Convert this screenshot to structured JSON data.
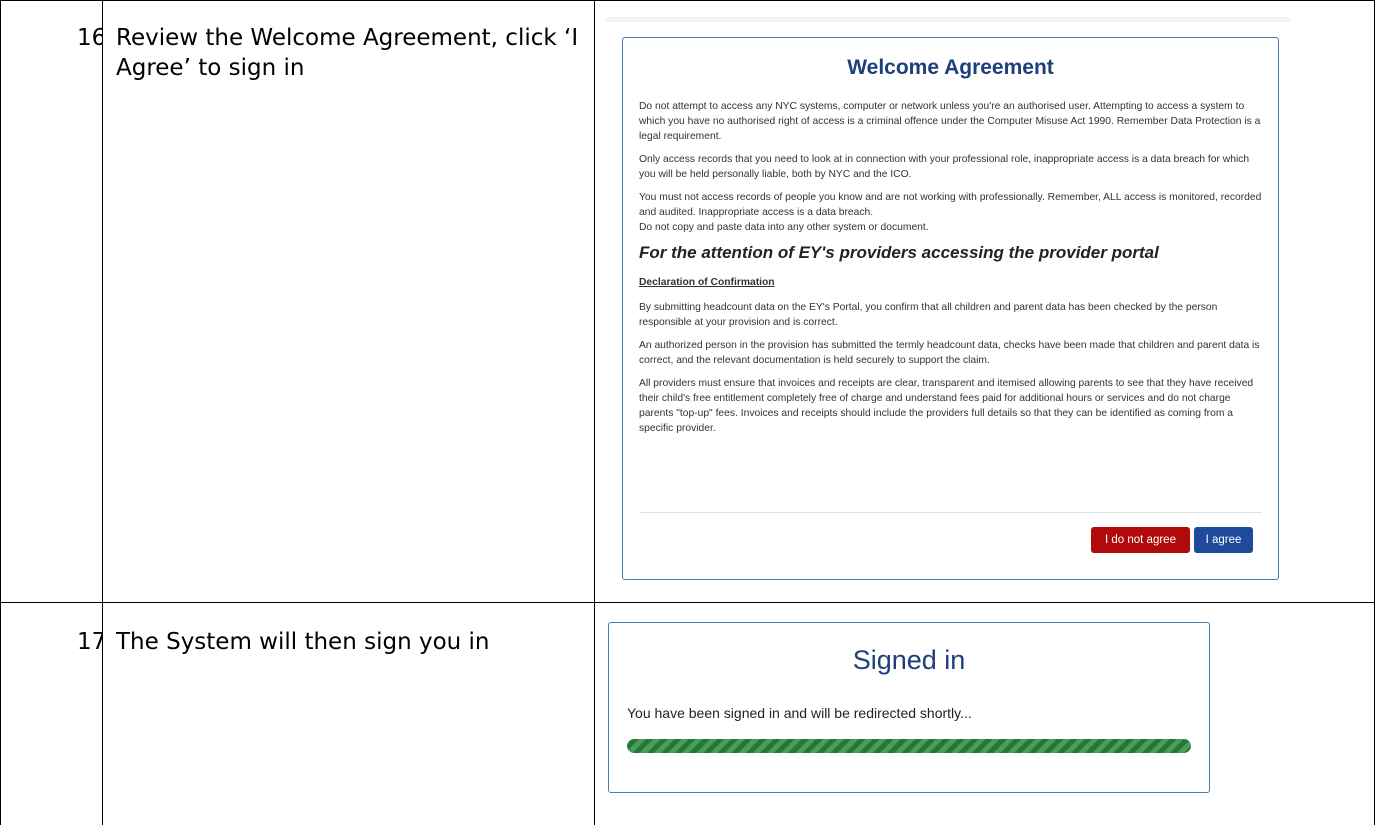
{
  "rows": [
    {
      "number": "16",
      "instruction": "Review the Welcome Agreement, click ‘I Agree’ to sign in"
    },
    {
      "number": "17",
      "instruction": "The System will then sign you in"
    }
  ],
  "welcome_agreement": {
    "title": "Welcome Agreement",
    "paragraphs": [
      "Do not attempt to access any NYC systems, computer or network unless you're an authorised user. Attempting to access a system to which you have no authorised right of access is a criminal offence under the Computer Misuse Act 1990. Remember Data Protection is a legal requirement.",
      "Only access records that you need to look at in connection with your professional role, inappropriate access is a data breach for which you will be held personally liable, both by NYC and the ICO.",
      "You must not access records of people you know and are not working with professionally. Remember, ALL access is monitored, recorded and audited. Inappropriate access is a data breach.",
      "Do not copy and paste data into any other system or document."
    ],
    "providers_heading": "For the attention of EY's providers accessing the provider portal",
    "declaration_title": "Declaration of Confirmation",
    "declaration_paragraphs": [
      "By submitting headcount data on the EY's Portal, you confirm that all children and parent data has been checked by the person responsible at your provision and is correct.",
      "An authorized person in the provision has submitted the termly headcount data, checks have been made that children and parent data is correct, and the relevant documentation is held securely to support the claim.",
      "All providers must ensure that invoices and receipts are clear, transparent and itemised allowing parents to see that they have received their child's free entitlement completely free of charge and understand fees paid for additional hours or services and do not charge parents \"top-up\" fees. Invoices and receipts should include the providers full details so that they can be identified as coming from a specific provider."
    ],
    "disagree_label": "I do not agree",
    "agree_label": "I agree",
    "disagree_color": "#b00a0a",
    "agree_color": "#1f4a9c"
  },
  "signed_in": {
    "title": "Signed in",
    "message": "You have been signed in and will be redirected shortly...",
    "progress_percent": 100,
    "progress_color": "#1f7a35"
  }
}
